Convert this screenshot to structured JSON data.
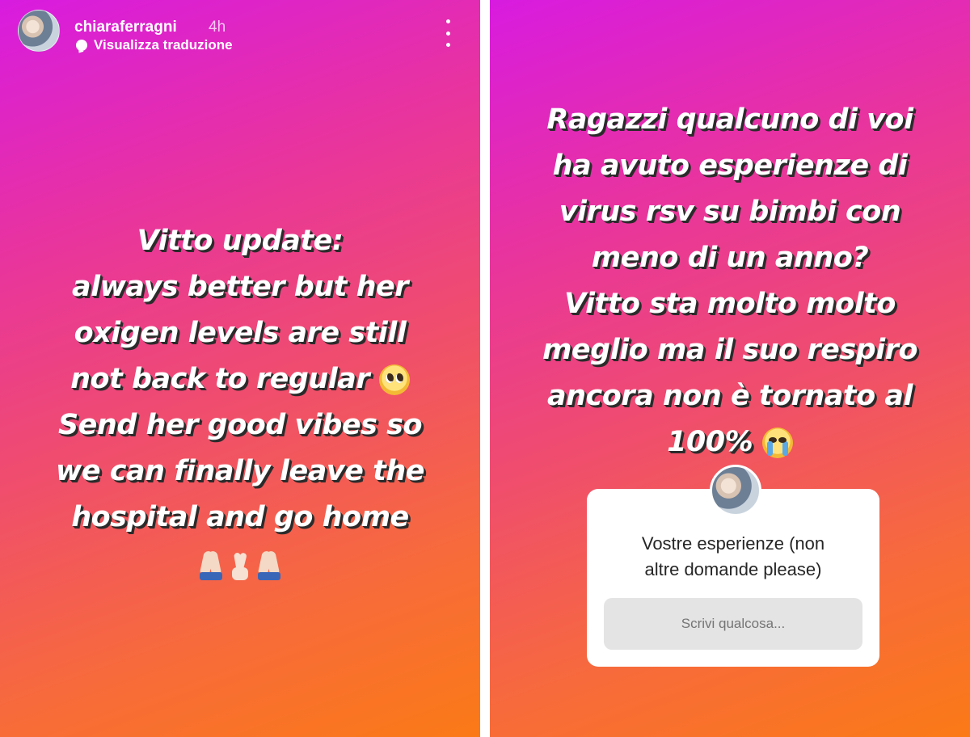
{
  "header": {
    "username": "chiaraferragni",
    "time": "4h",
    "translate_label": "Visualizza traduzione"
  },
  "left_story": {
    "lines": [
      "Vitto update:",
      "always better but her",
      "oxigen levels are still",
      "not back to regular",
      "Send her good vibes so",
      "we can finally leave the",
      "hospital and go home"
    ],
    "emojis": [
      "pleading-face",
      "folded-hands",
      "crossed-fingers",
      "folded-hands"
    ]
  },
  "right_story": {
    "lines": [
      "Ragazzi qualcuno di voi",
      "ha avuto esperienze di",
      "virus rsv su bimbi con",
      "meno di un anno?",
      "Vitto sta molto molto",
      "meglio ma il suo respiro",
      "ancora non è tornato al",
      "100%"
    ],
    "emojis": [
      "loudly-crying-face"
    ],
    "question": {
      "prompt_lines": [
        "Vostre esperienze (non",
        "altre domande please)"
      ],
      "placeholder": "Scrivi qualcosa..."
    }
  },
  "colors": {
    "gradient_top": "#d81be0",
    "gradient_mid": "#f04f6a",
    "gradient_bottom": "#fb7a16",
    "text": "#ffffff",
    "text_shadow": "#2b2b2b"
  }
}
